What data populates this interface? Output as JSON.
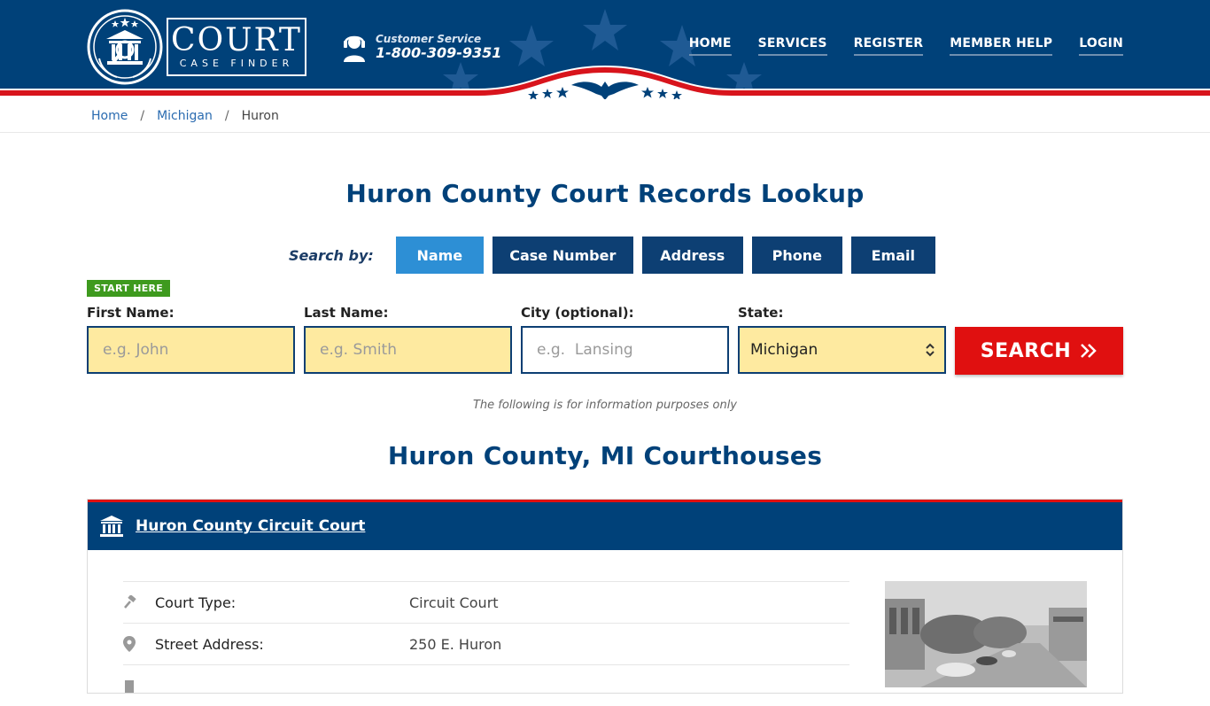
{
  "header": {
    "logo_main": "COURT",
    "logo_sub": "CASE FINDER",
    "customer_service_label": "Customer Service",
    "phone": "1-800-309-9351",
    "nav": [
      "HOME",
      "SERVICES",
      "REGISTER",
      "MEMBER HELP",
      "LOGIN"
    ]
  },
  "breadcrumb": {
    "home": "Home",
    "state": "Michigan",
    "current": "Huron"
  },
  "page_title": "Huron County Court Records Lookup",
  "search": {
    "label": "Search by:",
    "tabs": [
      "Name",
      "Case Number",
      "Address",
      "Phone",
      "Email"
    ],
    "active_tab": "Name",
    "start_badge": "START HERE",
    "first_name_label": "First Name:",
    "first_name_placeholder": "e.g. John",
    "last_name_label": "Last Name:",
    "last_name_placeholder": "e.g. Smith",
    "city_label": "City (optional):",
    "city_placeholder": "e.g.  Lansing",
    "state_label": "State:",
    "state_value": "Michigan",
    "button_label": "SEARCH"
  },
  "disclaimer": "The following is for information purposes only",
  "courthouses_title": "Huron County, MI Courthouses",
  "court": {
    "name": "Huron County Circuit Court",
    "rows": [
      {
        "key": "Court Type:",
        "value": "Circuit Court"
      },
      {
        "key": "Street Address:",
        "value": "250 E. Huron"
      }
    ]
  },
  "colors": {
    "brand_blue": "#004179",
    "accent_red": "#e01010",
    "active_tab": "#2d8fd5",
    "input_fill": "#feeaa0",
    "badge_green": "#3e9a1e"
  }
}
